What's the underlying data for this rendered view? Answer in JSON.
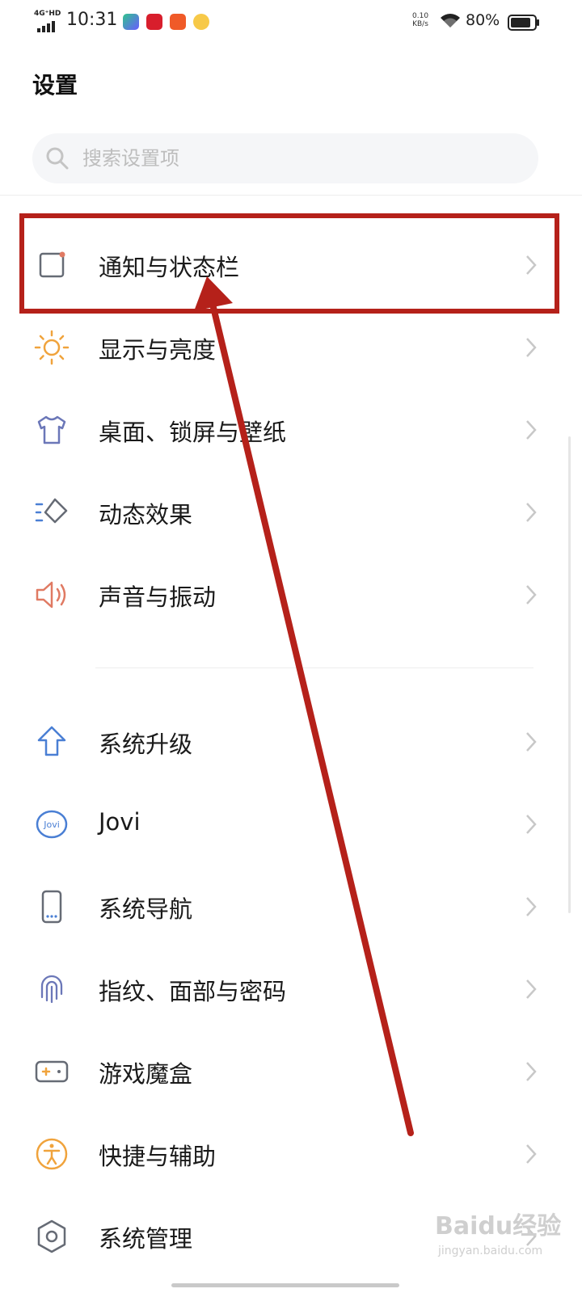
{
  "status_bar": {
    "network": "4G⁺HD",
    "time": "10:31",
    "net_speed": "0.10\nKB/s",
    "battery": "80%",
    "app_icons": [
      "iqiyi-icon",
      "app-red-icon",
      "bilibili-icon",
      "weibo-icon"
    ]
  },
  "header": {
    "title": "设置"
  },
  "search": {
    "placeholder": "搜索设置项"
  },
  "items": [
    {
      "label": "通知与状态栏",
      "icon": "notification-icon",
      "color": "#666b75"
    },
    {
      "label": "显示与亮度",
      "icon": "brightness-icon",
      "color": "#f0a33c"
    },
    {
      "label": "桌面、锁屏与壁纸",
      "icon": "tshirt-icon",
      "color": "#6b77b8"
    },
    {
      "label": "动态效果",
      "icon": "motion-icon",
      "color": "#4a7fd4"
    },
    {
      "label": "声音与振动",
      "icon": "speaker-icon",
      "color": "#e07a63"
    },
    {
      "label": "系统升级",
      "icon": "upgrade-arrow-icon",
      "color": "#4a7fd4"
    },
    {
      "label": "Jovi",
      "icon": "jovi-icon",
      "color": "#4a7fd4"
    },
    {
      "label": "系统导航",
      "icon": "phone-navigation-icon",
      "color": "#666b75"
    },
    {
      "label": "指纹、面部与密码",
      "icon": "fingerprint-icon",
      "color": "#6b77b8"
    },
    {
      "label": "游戏魔盒",
      "icon": "gamepad-icon",
      "color": "#666b75"
    },
    {
      "label": "快捷与辅助",
      "icon": "accessibility-icon",
      "color": "#f0a33c"
    },
    {
      "label": "系统管理",
      "icon": "hexagon-settings-icon",
      "color": "#666b75"
    }
  ],
  "annotation": {
    "highlight_color": "#b5211a"
  },
  "watermark": {
    "text": "Baidu经验",
    "sub": "jingyan.baidu.com"
  }
}
